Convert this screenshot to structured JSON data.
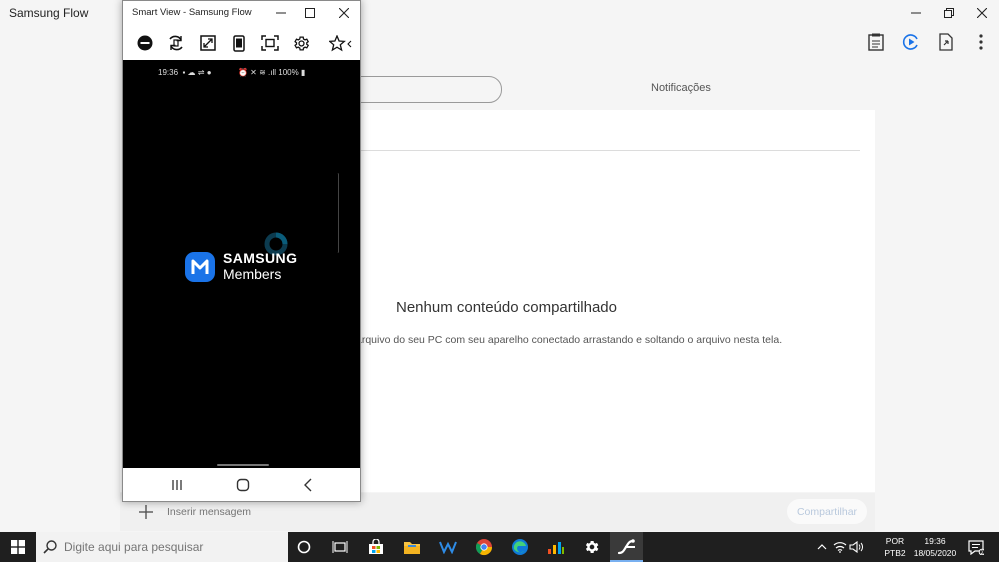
{
  "app": {
    "title": "Samsung Flow",
    "tabs": {
      "notifications": "Notificações"
    },
    "empty_title": "Nenhum conteúdo compartilhado",
    "empty_desc": "arquivo do seu PC com seu aparelho conectado arrastando e soltando o arquivo nesta tela.",
    "compose_placeholder": "Inserir mensagem",
    "share_label": "Compartilhar",
    "accent": "#1a73e8"
  },
  "smart_view": {
    "title": "Smart View - Samsung Flow",
    "status_time": "19:36",
    "status_battery": "100%",
    "brand_line1": "SAMSUNG",
    "brand_line2": "Members",
    "brand_color": "#1a73e8"
  },
  "taskbar": {
    "search_placeholder": "Digite aqui para pesquisar",
    "lang_line1": "POR",
    "lang_line2": "PTB2",
    "time": "19:36",
    "date": "18/05/2020"
  }
}
